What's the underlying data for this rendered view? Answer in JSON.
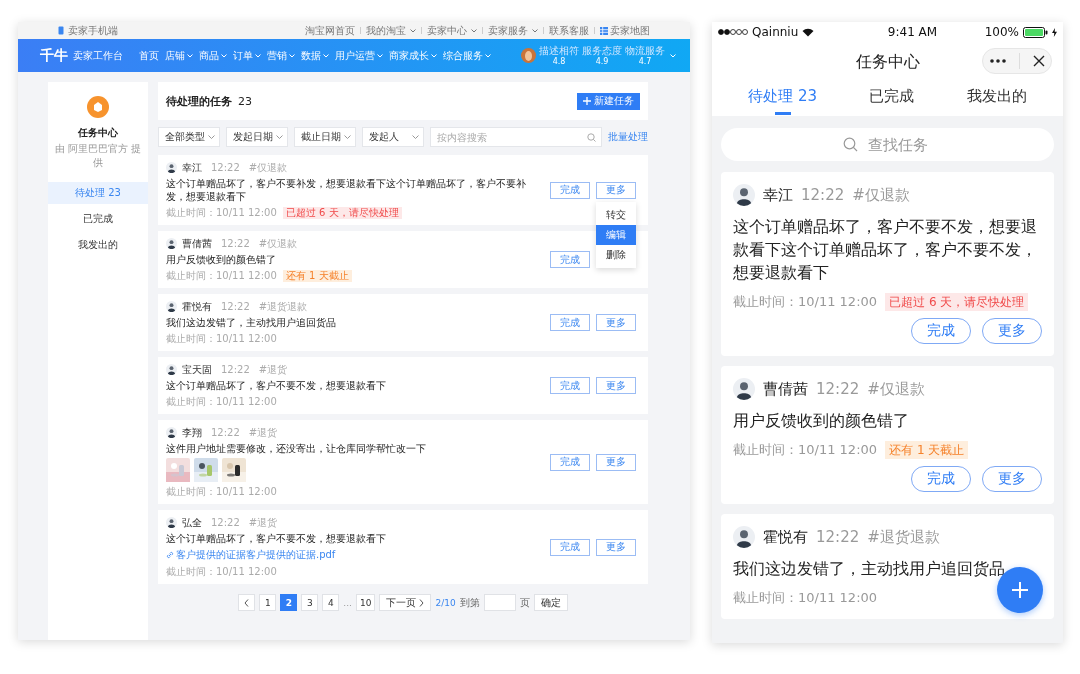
{
  "desktop": {
    "top_bar": {
      "mobile_link": "卖家手机端",
      "links": [
        {
          "label": "淘宝网首页",
          "dropdown": false
        },
        {
          "label": "我的淘宝",
          "dropdown": true
        },
        {
          "label": "卖家中心",
          "dropdown": true
        },
        {
          "label": "卖家服务",
          "dropdown": true
        },
        {
          "label": "联系客服",
          "dropdown": false
        },
        {
          "label": "卖家地图",
          "dropdown": false
        }
      ]
    },
    "nav": {
      "logo": "千牛",
      "subtitle": "卖家工作台",
      "items": [
        {
          "label": "首页",
          "dropdown": false
        },
        {
          "label": "店铺",
          "dropdown": true
        },
        {
          "label": "商品",
          "dropdown": true
        },
        {
          "label": "订单",
          "dropdown": true
        },
        {
          "label": "营销",
          "dropdown": true
        },
        {
          "label": "数据",
          "dropdown": true
        },
        {
          "label": "用户运营",
          "dropdown": true
        },
        {
          "label": "商家成长",
          "dropdown": true
        },
        {
          "label": "综合服务",
          "dropdown": true
        }
      ],
      "ratings": [
        {
          "label": "描述相符",
          "value": "4.8"
        },
        {
          "label": "服务态度",
          "value": "4.9"
        },
        {
          "label": "物流服务",
          "value": "4.7"
        }
      ]
    },
    "sidebar": {
      "title": "任务中心",
      "subtitle": "由 阿里巴巴官方 提供",
      "items": [
        {
          "label": "待处理 23",
          "selected": true
        },
        {
          "label": "已完成",
          "selected": false
        },
        {
          "label": "我发出的",
          "selected": false
        }
      ]
    },
    "header": {
      "title": "待处理的任务",
      "count": "23",
      "new_button": "新建任务"
    },
    "filters": {
      "selects": [
        "全部类型",
        "发起日期",
        "截止日期",
        "发起人"
      ],
      "search_placeholder": "按内容搜索",
      "batch": "批量处理"
    },
    "tasks": [
      {
        "author": "幸江",
        "time": "12:22",
        "tag": "#仅退款",
        "text": "这个订单赠品坏了，客户不要补发，想要退款看下这个订单赠品坏了，客户不要补发，想要退款看下",
        "deadline": "截止时间：10/11 12:00",
        "badge": {
          "kind": "danger",
          "text": "已超过 6 天，请尽快处理"
        },
        "buttons": [
          "完成",
          "更多"
        ],
        "menu": [
          {
            "label": "转交",
            "selected": false
          },
          {
            "label": "编辑",
            "selected": true
          },
          {
            "label": "删除",
            "selected": false
          }
        ]
      },
      {
        "author": "曹倩茜",
        "time": "12:22",
        "tag": "#仅退款",
        "text": "用户反馈收到的颜色错了",
        "deadline": "截止时间：10/11 12:00",
        "badge": {
          "kind": "warning",
          "text": "还有 1 天截止"
        },
        "buttons": [
          "完成"
        ]
      },
      {
        "author": "霍悦有",
        "time": "12:22",
        "tag": "#退货退款",
        "text": "我们这边发错了，主动找用户追回货品",
        "deadline": "截止时间：10/11 12:00",
        "buttons": [
          "完成",
          "更多"
        ]
      },
      {
        "author": "宝天固",
        "time": "12:22",
        "tag": "#退货",
        "text": "这个订单赠品坏了，客户不要不发，想要退款看下",
        "deadline": "截止时间：10/11 12:00",
        "buttons": [
          "完成",
          "更多"
        ]
      },
      {
        "author": "李翔",
        "time": "12:22",
        "tag": "#退货",
        "text": "这件用户地址需要修改，还没寄出，让仓库同学帮忙改一下",
        "images": [
          {
            "kind": "picture"
          },
          {
            "kind": "picture"
          },
          {
            "kind": "picture"
          }
        ],
        "deadline": "截止时间：10/11 12:00",
        "buttons": [
          "完成",
          "更多"
        ]
      },
      {
        "author": "弘全",
        "time": "12:22",
        "tag": "#退货",
        "text": "这个订单赠品坏了，客户不要不发，想要退款看下",
        "attachment": "客户提供的证据客户提供的证据.pdf",
        "deadline": "截止时间：10/11 12:00",
        "buttons": [
          "完成",
          "更多"
        ]
      }
    ],
    "pagination": {
      "items": [
        {
          "kind": "prev"
        },
        {
          "kind": "page",
          "label": "1",
          "selected": false
        },
        {
          "kind": "page",
          "label": "2",
          "selected": true
        },
        {
          "kind": "page",
          "label": "3",
          "selected": false
        },
        {
          "kind": "page",
          "label": "4",
          "selected": false
        },
        {
          "kind": "ellipsis",
          "label": "..."
        },
        {
          "kind": "page",
          "label": "10",
          "selected": false
        },
        {
          "kind": "next",
          "label": "下一页"
        }
      ],
      "status": "2/10",
      "goto_label": "到第",
      "page_unit": "页",
      "confirm": "确定"
    }
  },
  "phone": {
    "status_bar": {
      "carrier": "Qainniu",
      "time": "9:41 AM",
      "battery": "100%"
    },
    "title": "任务中心",
    "tabs": [
      {
        "label": "待处理 23",
        "selected": true
      },
      {
        "label": "已完成",
        "selected": false
      },
      {
        "label": "我发出的",
        "selected": false
      }
    ],
    "search_placeholder": "查找任务",
    "tasks": [
      {
        "author": "幸江",
        "time": "12:22",
        "tag": "#仅退款",
        "text": "这个订单赠品坏了，客户不要不发，想要退款看下这个订单赠品坏了，客户不要不发，想要退款看下",
        "deadline": "截止时间：10/11 12:00",
        "badge": {
          "kind": "danger",
          "text": "已超过 6 天，请尽快处理"
        },
        "buttons": [
          "完成",
          "更多"
        ]
      },
      {
        "author": "曹倩茜",
        "time": "12:22",
        "tag": "#仅退款",
        "text": "用户反馈收到的颜色错了",
        "deadline": "截止时间：10/11 12:00",
        "badge": {
          "kind": "warning",
          "text": "还有 1 天截止"
        },
        "buttons": [
          "完成",
          "更多"
        ]
      },
      {
        "author": "霍悦有",
        "time": "12:22",
        "tag": "#退货退款",
        "text": "我们这边发错了，主动找用户追回货品",
        "deadline": "截止时间：10/11 12:00"
      }
    ]
  }
}
